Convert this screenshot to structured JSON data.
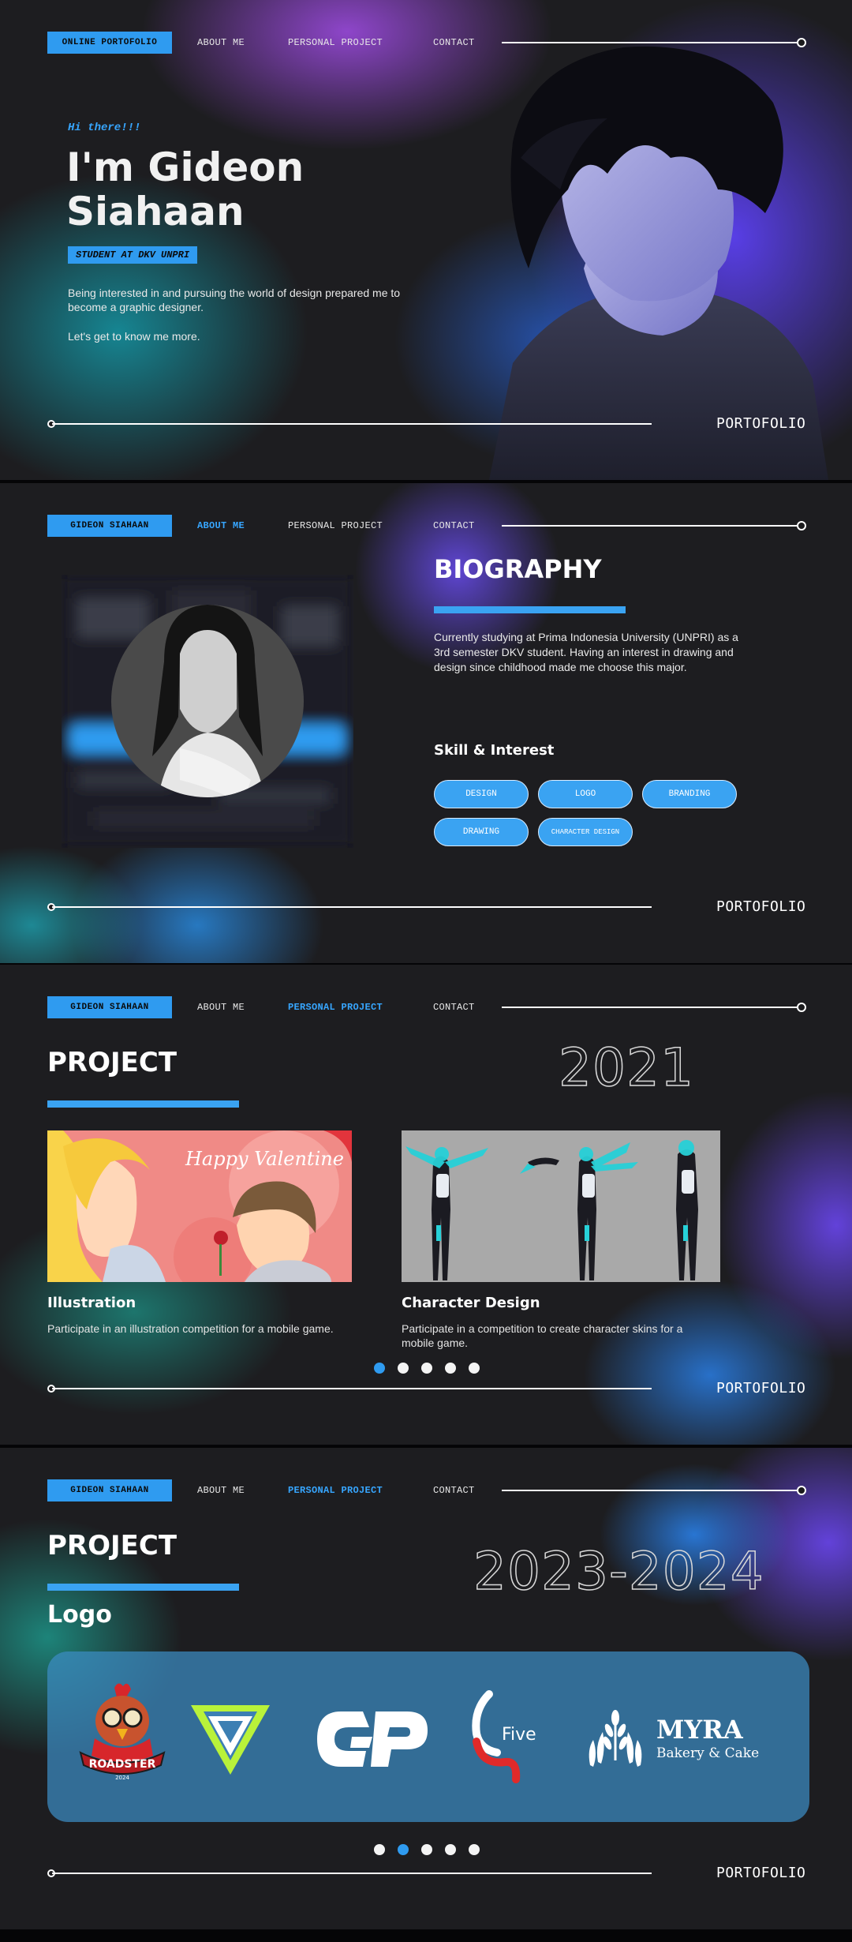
{
  "nav": {
    "brand_home": "ONLINE PORTOFOLIO",
    "brand_name": "GIDEON SIAHAAN",
    "about": "ABOUT ME",
    "project": "PERSONAL PROJECT",
    "contact": "CONTACT"
  },
  "footer_label": "PORTOFOLIO",
  "hero": {
    "greeting": "Hi there!!!",
    "name_line1": "I'm Gideon",
    "name_line2": "Siahaan",
    "role": "STUDENT AT DKV UNPRI",
    "intro": "Being interested in and pursuing the world of design prepared me to become a graphic designer.",
    "cta": "Let's get to know me more."
  },
  "about": {
    "title": "BIOGRAPHY",
    "bio": "Currently studying at Prima Indonesia University (UNPRI) as a 3rd semester DKV student. Having an interest in drawing and design since childhood made me choose this major.",
    "skills_title": "Skill & Interest",
    "skills": [
      "DESIGN",
      "LOGO",
      "BRANDING",
      "DRAWING",
      "CHARACTER DESIGN"
    ]
  },
  "project_2021": {
    "title": "PROJECT",
    "year": "2021",
    "cards": [
      {
        "title": "Illustration",
        "desc": "Participate in an illustration competition for a mobile game.",
        "image_text": "Happy Valentine"
      },
      {
        "title": "Character Design",
        "desc": "Participate in a competition to create character skins for a mobile game."
      }
    ],
    "active_dot": 1
  },
  "project_2023": {
    "title": "PROJECT",
    "year": "2023-2024",
    "subtitle": "Logo",
    "logos": [
      {
        "name": "ROADSTER",
        "sub": "2024"
      },
      {
        "name": "diamond-v"
      },
      {
        "name": "GP"
      },
      {
        "name": "Five"
      },
      {
        "name": "MYRA",
        "sub": "Bakery & Cake"
      }
    ],
    "active_dot": 2
  },
  "colors": {
    "accent": "#2f9bf0",
    "purple": "#7b4cf2",
    "teal": "#1aa6a0"
  }
}
